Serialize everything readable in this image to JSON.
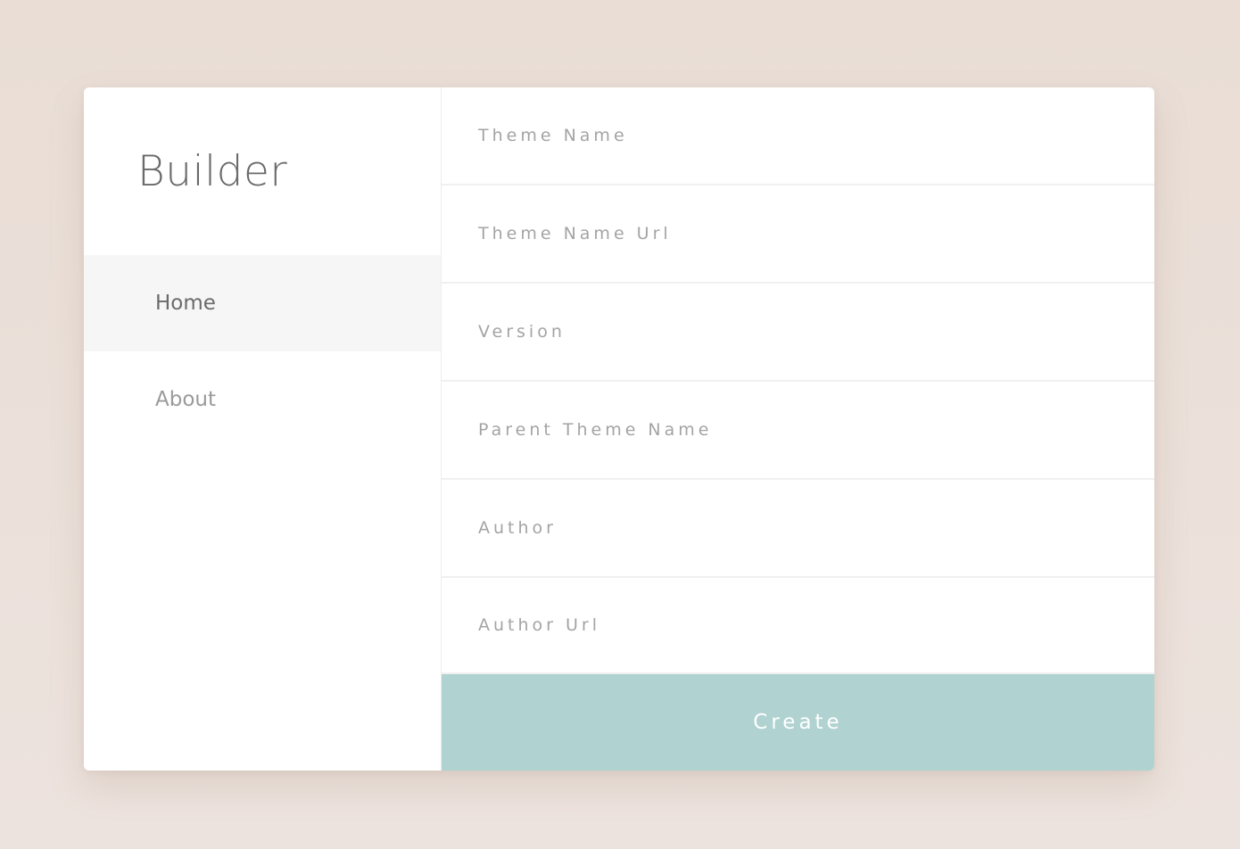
{
  "app": {
    "title": "Builder"
  },
  "sidebar": {
    "items": [
      {
        "label": "Home",
        "active": true
      },
      {
        "label": "About",
        "active": false
      }
    ]
  },
  "form": {
    "fields": [
      {
        "placeholder": "Theme Name",
        "value": ""
      },
      {
        "placeholder": "Theme Name Url",
        "value": ""
      },
      {
        "placeholder": "Version",
        "value": ""
      },
      {
        "placeholder": "Parent Theme Name",
        "value": ""
      },
      {
        "placeholder": "Author",
        "value": ""
      },
      {
        "placeholder": "Author Url",
        "value": ""
      }
    ],
    "submit_label": "Create"
  },
  "colors": {
    "accent": "#b0d2d1",
    "background": "#e9ddd5",
    "active_nav_bg": "#f6f6f6"
  }
}
